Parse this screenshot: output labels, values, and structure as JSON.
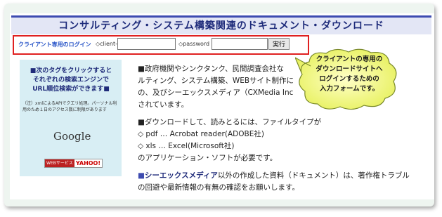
{
  "header": {
    "title": "コンサルティング・システム構築関連のドキュメント・ダウンロード"
  },
  "login": {
    "label": "クライアント専用のログイン",
    "clientid_label": "◇client-ID",
    "clientid_value": "",
    "password_label": "◇password",
    "password_value": "",
    "submit_label": "実行"
  },
  "sidebar": {
    "line1": "■次のタグをクリックすると",
    "line2": "それぞれの検索エンジンで",
    "line3": "URL順位検索ができます■",
    "note": "（注）xmlによるAPIでクエリ処理。パーソナル利用のため１日のアクセス数に制限があります",
    "google": "Google",
    "badge_left": "WEBサービス",
    "badge_right": "YAHOO!"
  },
  "main": {
    "p1a": "■政府機関やシンクタンク、民間調査会社な",
    "p1b": "ルティング、システム構築、WEBサイト制作に",
    "p1c": "の、及びシーエックスメディア（CXMedia Inc",
    "p1d": "されています。",
    "p2a": "■ダウンロードして、読みとるには、ファイルタイプが",
    "p2b": "◇ pdf … Acrobat reader(ADOBE社)",
    "p2c": "◇ xls … Excel(Microsoft社)",
    "p2d": "のアプリケーション・ソフトが必要です。",
    "p3_sq": "■",
    "p3_strong": "シーエックスメディア",
    "p3_rest": "以外の作成した資料（ドキュメント）は、著作権トラブル",
    "p3b": "の回避や最新情報の有無の確認をお願いします。"
  },
  "callout": {
    "line1": "クライアントの専用の",
    "line2": "ダウンロードサイトへ",
    "line3": "ログインするための",
    "line4": "入力フォームです。"
  }
}
